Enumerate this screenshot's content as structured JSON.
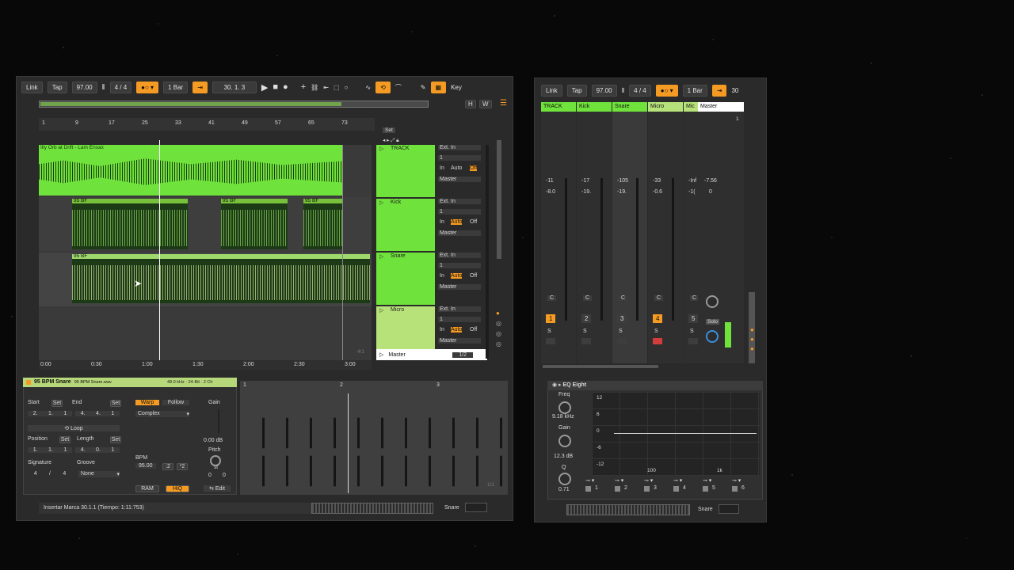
{
  "arrangement": {
    "transport": {
      "link": "Link",
      "tap": "Tap",
      "tempo": "97.00",
      "meter": "4 / 4",
      "quantize": "1 Bar",
      "position": "30.  1.  3",
      "key": "Key"
    },
    "ruler": [
      "1",
      "9",
      "17",
      "25",
      "33",
      "41",
      "49",
      "57",
      "65",
      "73"
    ],
    "time_ruler": [
      "0:00",
      "0:30",
      "1:00",
      "1:30",
      "2:00",
      "2:30",
      "3:00"
    ],
    "clip_label_top": "Illy Orb at Drift - Lam Ensax",
    "clip_label_kick": "95 BF",
    "set_label": "Set",
    "page_fraction": "4/1",
    "tracks": [
      {
        "name": "TRACK",
        "input": "Ext. In",
        "channel": "1",
        "in": "In",
        "auto": "Auto",
        "off": "Off",
        "out": "Master"
      },
      {
        "name": "Kick",
        "input": "Ext. In",
        "channel": "1",
        "in": "In",
        "auto": "Auto",
        "off": "Off",
        "out": "Master"
      },
      {
        "name": "Snare",
        "input": "Ext. In",
        "channel": "1",
        "in": "In",
        "auto": "Auto",
        "off": "Off",
        "out": "Master"
      },
      {
        "name": "Micro",
        "input": "Ext. In",
        "channel": "1",
        "in": "In",
        "auto": "Auto",
        "off": "Off",
        "out": "Master"
      }
    ],
    "master": {
      "name": "Master",
      "out": "1/2"
    }
  },
  "clip": {
    "title": "95 BPM Snare",
    "file": "95 BPM Snare.wav",
    "format": "48.0 kHz · 24-Bit · 2 Ch",
    "start_label": "Start",
    "end_label": "End",
    "set": "Set",
    "start": [
      "2.",
      "1.",
      "1"
    ],
    "end": [
      "4.",
      "4.",
      "1"
    ],
    "loop": "Loop",
    "position_label": "Position",
    "length_label": "Length",
    "position": [
      "1.",
      "1.",
      "1"
    ],
    "length": [
      "4.",
      "0.",
      "1"
    ],
    "signature_label": "Signature",
    "groove_label": "Groove",
    "signature": [
      "4",
      "4"
    ],
    "groove": "None",
    "warp": "Warp",
    "follow": "Follow",
    "mode": "Complex",
    "bpm_label": "BPM",
    "bpm": "95.00",
    "half": ":2",
    "double": "*2",
    "ram": "RAM",
    "hiq": "HiQ",
    "gain_label": "Gain",
    "gain": "0.00 dB",
    "pitch_label": "Pitch",
    "pitch_st": "st",
    "pitch": [
      "0",
      "0"
    ],
    "edit": "Edit",
    "ruler": [
      "1",
      "2",
      "3"
    ],
    "page_fraction": "1/1"
  },
  "status": {
    "text": "Insertar Marca 30.1.1 (Tiempo: 1:11:753)",
    "track": "Snare"
  },
  "mixer": {
    "transport": {
      "link": "Link",
      "tap": "Tap",
      "tempo": "97.00",
      "meter": "4 / 4",
      "quantize": "1 Bar",
      "position": "30"
    },
    "channels": [
      {
        "name": "TRACK",
        "peak": "-11",
        "vol": "-8.0",
        "num": "1",
        "color": "#6fe33b"
      },
      {
        "name": "Kick",
        "peak": "-17",
        "vol": "-19.",
        "num": "2",
        "color": "#6fe33b"
      },
      {
        "name": "Snare",
        "peak": "-105",
        "vol": "-19.",
        "num": "3",
        "color": "#6fe33b"
      },
      {
        "name": "Micro",
        "peak": "-33",
        "vol": "-0.6",
        "num": "4",
        "color": "#b7e27a"
      },
      {
        "name": "Mic",
        "peak": "-Inf",
        "vol": "-1(",
        "num": "5",
        "color": "#b7e27a"
      }
    ],
    "master": {
      "name": "Master",
      "num": "1",
      "peak": "-7.56",
      "vol": "0",
      "solo": "Solo"
    },
    "c_label": "C",
    "s_label": "S"
  },
  "eq": {
    "title": "EQ Eight",
    "freq_label": "Freq",
    "freq": "9.18 kHz",
    "gain_label": "Gain",
    "gain": "12.3 dB",
    "q_label": "Q",
    "q": "0.71",
    "db_ticks": [
      "12",
      "6",
      "0",
      "-6",
      "-12"
    ],
    "freq_ticks": [
      "100",
      "1k"
    ],
    "bands": [
      "1",
      "2",
      "3",
      "4",
      "5",
      "6"
    ]
  },
  "mixer_status": {
    "track": "Snare"
  },
  "colors": {
    "accent": "#f59b23",
    "clip_green": "#6fe33b",
    "micro_green": "#b7e27a"
  }
}
